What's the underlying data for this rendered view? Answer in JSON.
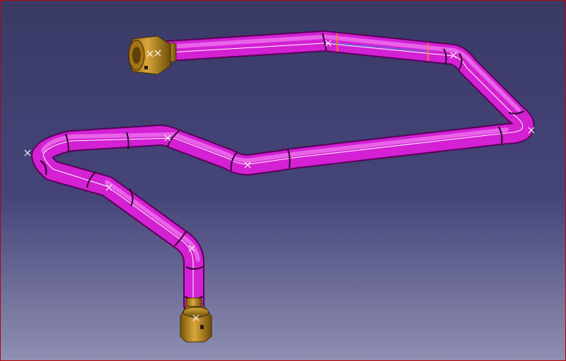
{
  "viewport": {
    "border_color": "#c00000",
    "background_top": "#3a3a66",
    "background_bottom": "#8f8fb2"
  },
  "colors": {
    "pipe": "#d321d3",
    "pipe_highlight": "#f07af0",
    "pipe_outline": "#5a005a",
    "centerline": "#ffffff",
    "fitting": "#b8861b",
    "fitting_dark": "#6e4e08",
    "segment_marker": "#ff8800",
    "construction_point": "#ffffff"
  },
  "icons": [
    "construction-point-x-icon",
    "fitting-nut-icon"
  ]
}
